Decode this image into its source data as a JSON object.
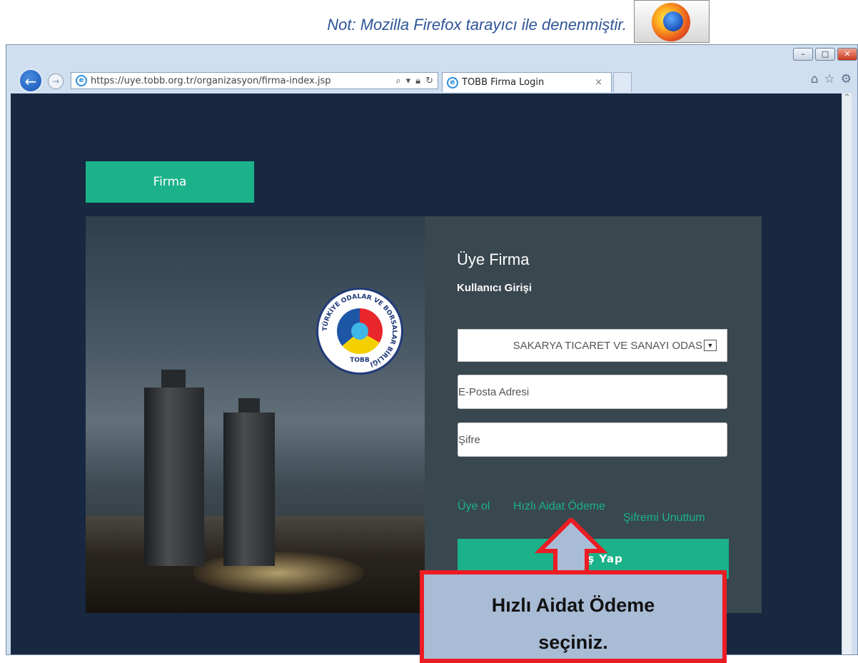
{
  "annotation": {
    "note": "Not: Mozilla Firefox tarayıcı ile denenmiştir.",
    "callout_line1": "Hızlı Aidat Ödeme",
    "callout_line2": "seçiniz."
  },
  "browser": {
    "url": "https://uye.tobb.org.tr/organizasyon/firma-index.jsp",
    "tab_title": "TOBB Firma Login",
    "tab_close": "×"
  },
  "page": {
    "firma_tab": "Firma",
    "title": "Üye Firma",
    "subtitle": "Kullanıcı Girişi",
    "chamber_select_value": "SAKARYA TICARET VE SANAYI ODAS",
    "email_placeholder": "E-Posta Adresi",
    "password_placeholder": "Şifre",
    "link_register": "Üye ol",
    "link_quick_pay": "Hızlı Aidat Ödeme",
    "link_forgot": "Şifremi Unuttum",
    "login_button": "Giriş Yap",
    "logo_ring_text": "TÜRKİYE ODALAR VE BORSALAR BİRLİĞİ",
    "logo_abbr": "TOBB"
  },
  "colors": {
    "page_bg": "#172840",
    "accent": "#1bb28a",
    "panel": "#39474f",
    "callout_border": "#ec1c24",
    "callout_fill": "#a9bcd6"
  }
}
